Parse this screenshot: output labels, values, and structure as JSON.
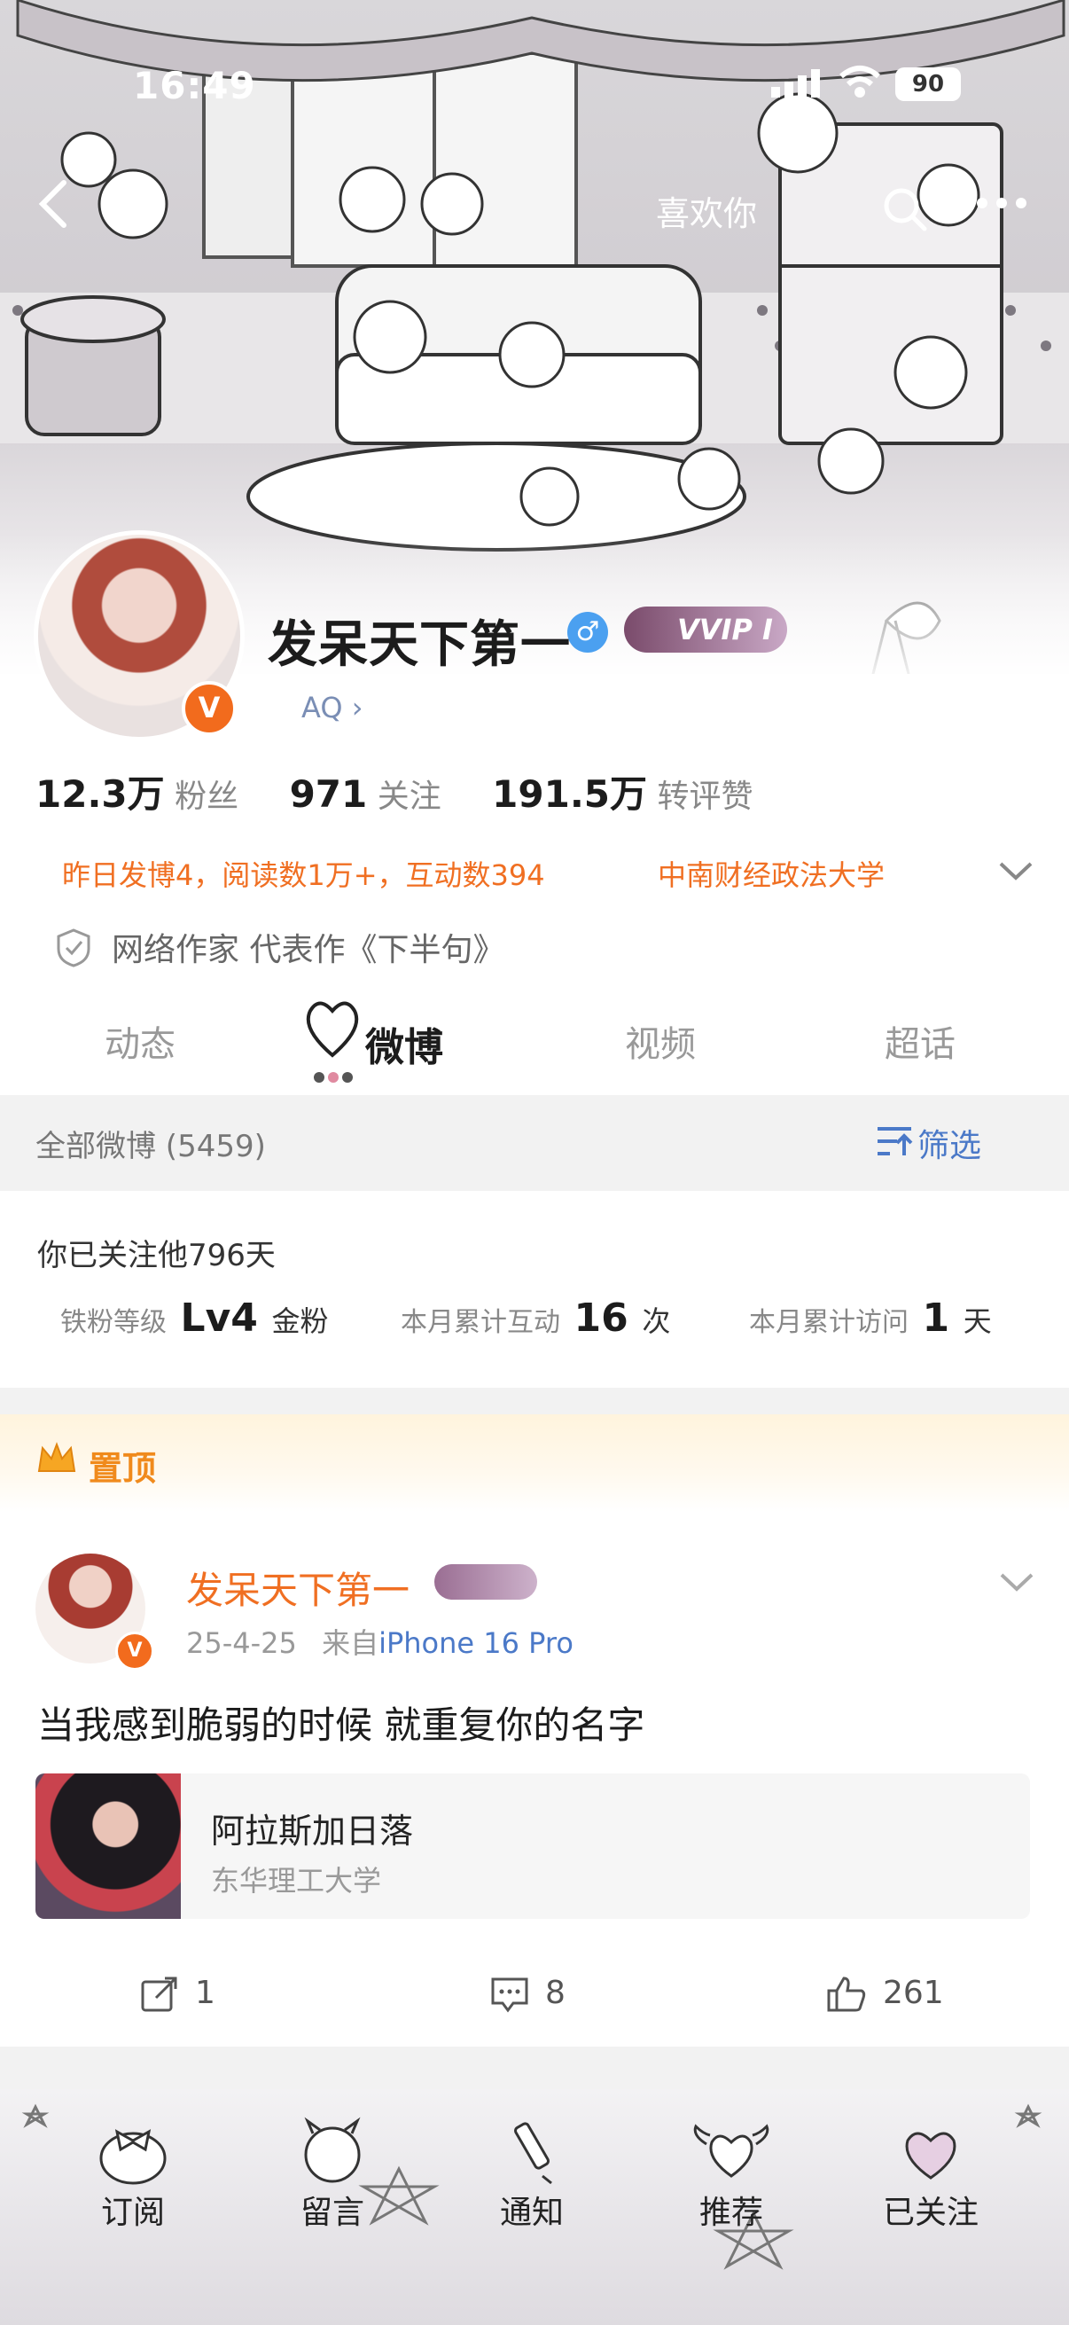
{
  "status_bar": {
    "time": "16:49",
    "battery": "90"
  },
  "top_bar": {
    "title": "喜欢你"
  },
  "profile": {
    "name": "发呆天下第一",
    "vip_badge": "VVIP I",
    "ip_chip": "AQ",
    "verified": "V"
  },
  "stats": [
    {
      "value": "12.3万",
      "label": "粉丝"
    },
    {
      "value": "971",
      "label": "关注"
    },
    {
      "value": "191.5万",
      "label": "转评赞"
    }
  ],
  "summary_line": "昨日发博4，阅读数1万+，互动数394",
  "school": "中南财经政法大学",
  "certification": "网络作家 代表作《下半句》",
  "tabs": [
    "动态",
    "微博",
    "视频",
    "超话"
  ],
  "active_tab": "微博",
  "filter": {
    "title": "全部微博 (5459)",
    "button": "筛选"
  },
  "follow_info": {
    "days": "你已关注他796天",
    "level_label": "铁粉等级",
    "level_value": "Lv4",
    "level_unit": "金粉",
    "interact_label": "本月累计互动",
    "interact_value": "16",
    "interact_unit": "次",
    "visit_label": "本月累计访问",
    "visit_value": "1",
    "visit_unit": "天"
  },
  "pinned": {
    "label": "置顶",
    "author": "发呆天下第一",
    "date": "25-4-25",
    "source_prefix": "来自",
    "source": "iPhone 16 Pro",
    "text": "当我感到脆弱的时候 就重复你的名字",
    "card": {
      "title": "阿拉斯加日落",
      "subtitle": "东华理工大学"
    },
    "reposts": "1",
    "comments": "8",
    "likes": "261"
  },
  "bottom_nav": [
    "订阅",
    "留言",
    "通知",
    "推荐",
    "已关注"
  ],
  "colors": {
    "accent_orange": "#f06f22",
    "link_blue": "#4b79c8",
    "gold": "#f08a1c"
  }
}
